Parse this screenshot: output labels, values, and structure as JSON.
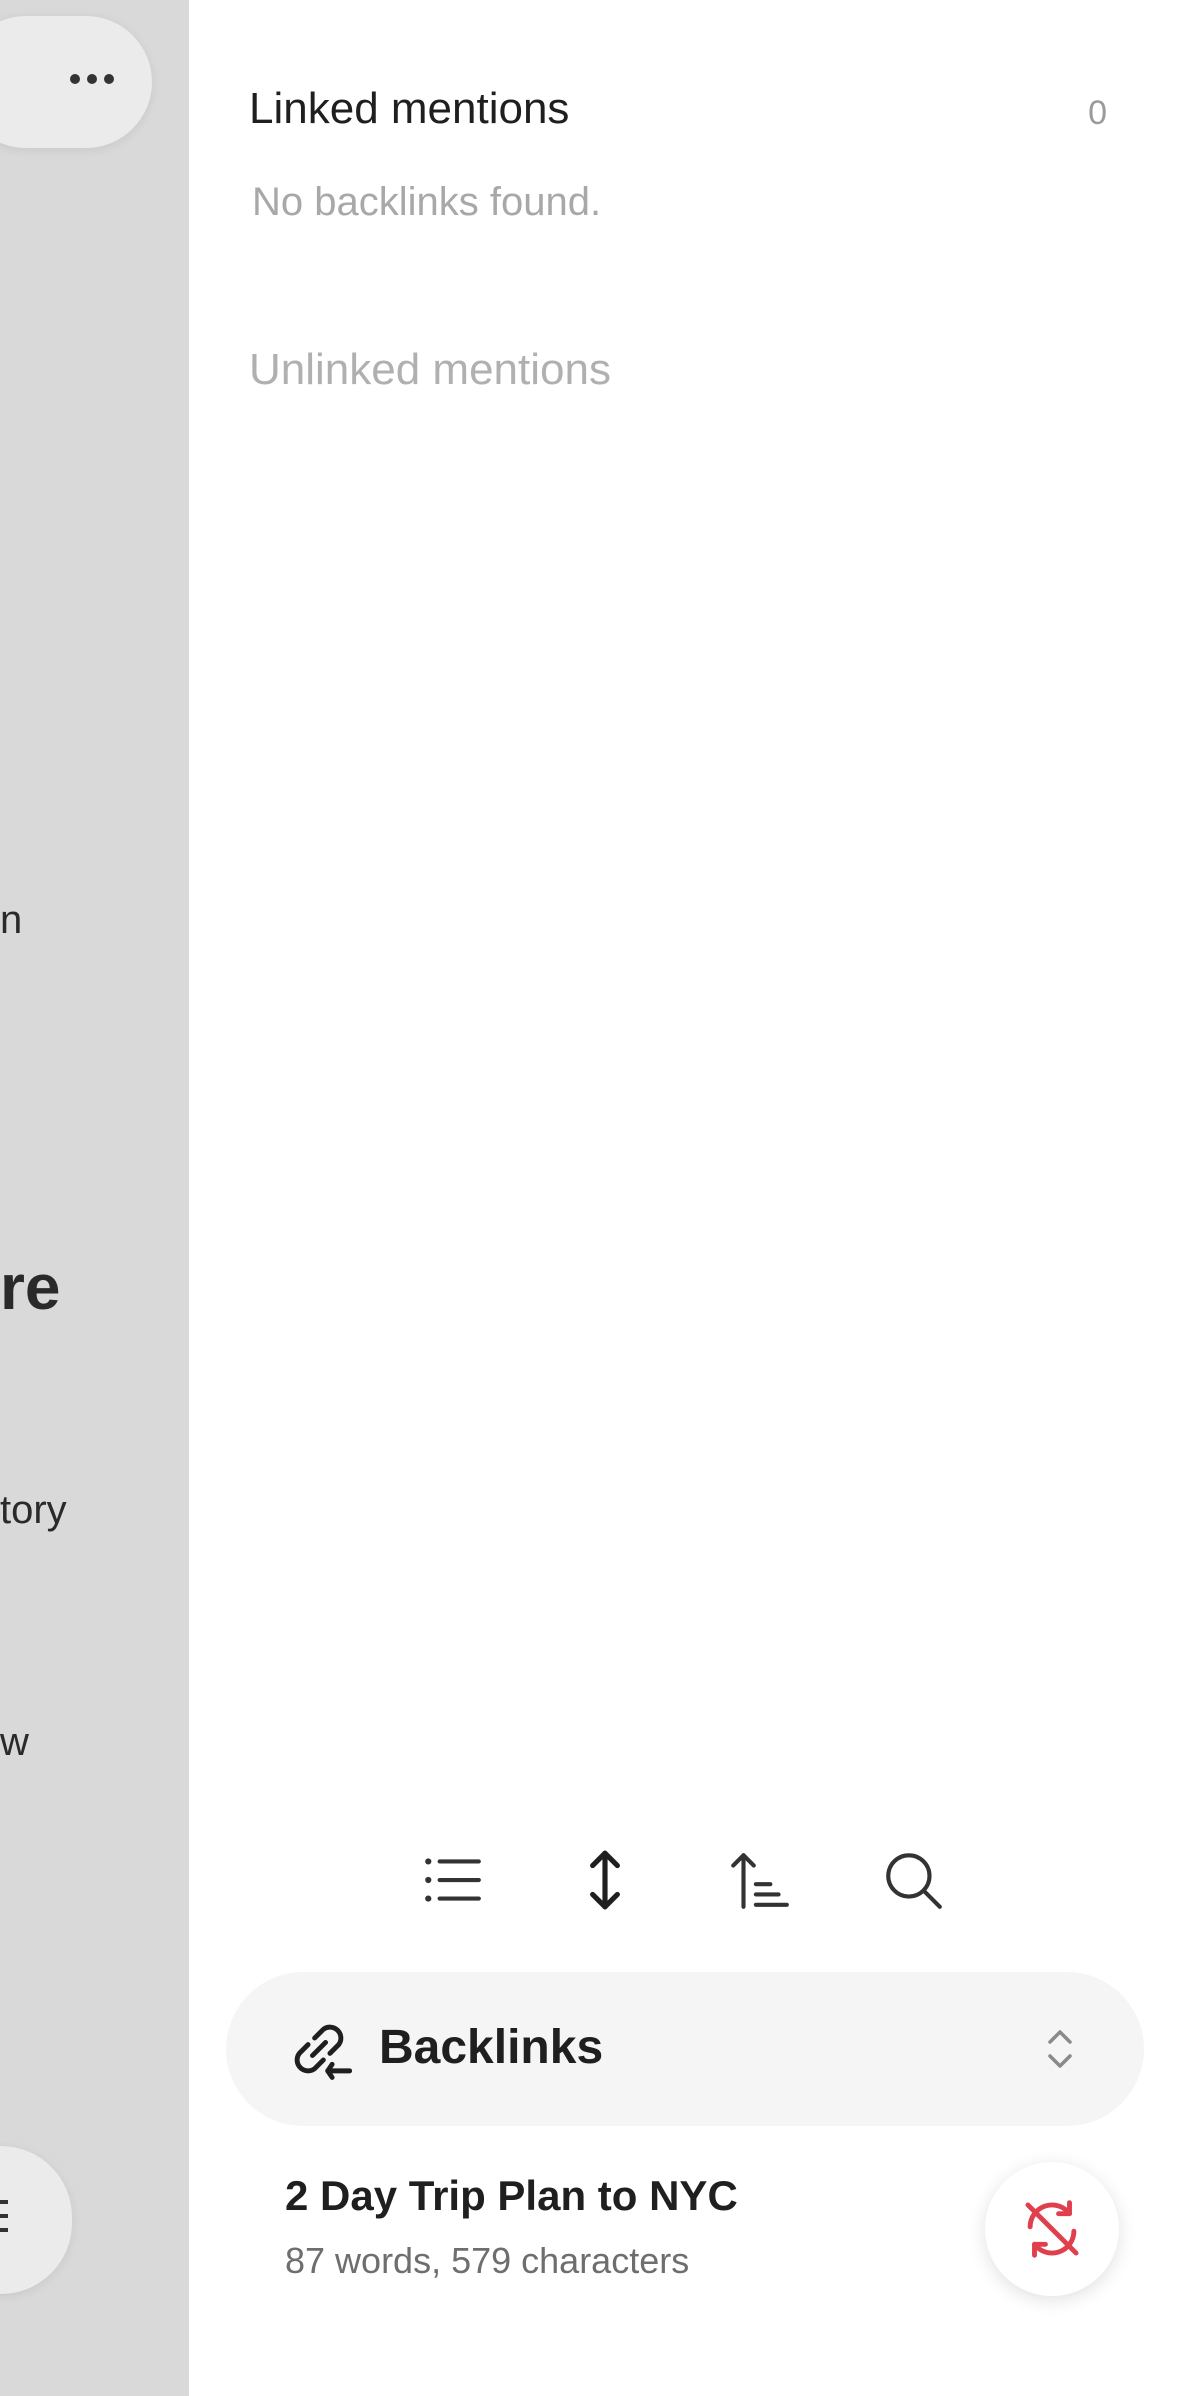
{
  "background": {
    "fragments": [
      "n",
      "re",
      "tory",
      "w"
    ]
  },
  "backlinks": {
    "linked_title": "Linked mentions",
    "linked_count": "0",
    "empty_text": "No backlinks found.",
    "unlinked_title": "Unlinked mentions"
  },
  "selector": {
    "label": "Backlinks"
  },
  "note": {
    "title": "2 Day Trip Plan to NYC",
    "meta": "87 words, 579 characters"
  },
  "colors": {
    "sync_error": "#e0404e",
    "icon": "#333333"
  },
  "icons": {
    "toolbar": [
      "list-icon",
      "expand-vertical-icon",
      "sort-icon",
      "search-icon"
    ],
    "selector": "backlink-icon",
    "fab": "sync-off-icon"
  }
}
